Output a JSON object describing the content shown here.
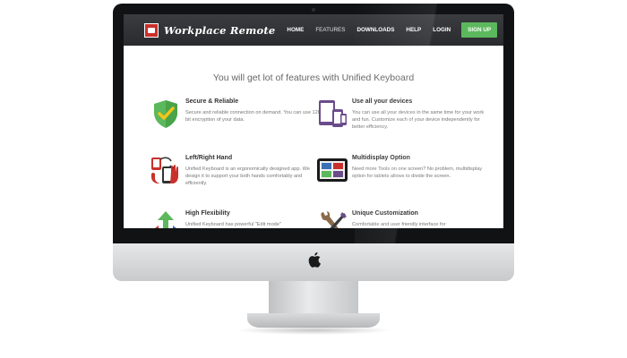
{
  "site": {
    "brand": "Workplace Remote",
    "nav": [
      "HOME",
      "FEATURES",
      "DOWNLOADS",
      "HELP",
      "LOGIN"
    ],
    "signup": "SIGN UP"
  },
  "headline": "You will get lot of features with Unified Keyboard",
  "features": [
    {
      "title": "Secure & Reliable",
      "description": "Secure and reliable connection on demand. You can use 128 bit encryption of your data.",
      "icon": "shield-check-icon"
    },
    {
      "title": "Use all your devices",
      "description": "You can use all your devices in the same time for your work and fun. Customize each of your device independently for better efficiency.",
      "icon": "devices-icon"
    },
    {
      "title": "Left/Right Hand",
      "description": "Unified Keyboard is an ergonomically designed app. We design it to support your both hands comfortably and efficiently.",
      "icon": "hands-icon"
    },
    {
      "title": "Multidisplay Option",
      "description": "Need more Tools on one screen? No problem, multidisplay option for tablets allows to divide the screen.",
      "icon": "multidisplay-icon"
    },
    {
      "title": "High Flexibility",
      "description": "Unified Keyboard has powerful \"Edit mode\"",
      "icon": "arrows-icon"
    },
    {
      "title": "Unique Customization",
      "description": "Comfortable and user friendly interface for",
      "icon": "tools-icon"
    }
  ],
  "colors": {
    "nav_bg": "#2e3033",
    "signup_bg": "#5cb85c",
    "brand_logo": "#c9302c",
    "shield_green": "#5cb85c",
    "devices_purple": "#6b4c8a"
  }
}
